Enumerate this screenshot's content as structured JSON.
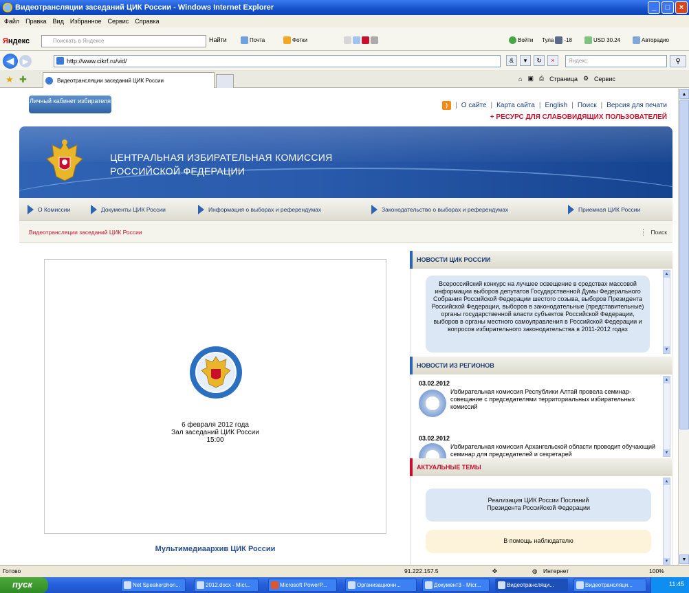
{
  "window": {
    "title": "Видеотрансляции заседаний ЦИК России - Windows Internet Explorer",
    "min": "_",
    "max": "□",
    "close": "×"
  },
  "menu": [
    "Файл",
    "Правка",
    "Вид",
    "Избранное",
    "Сервис",
    "Справка"
  ],
  "yandex_bar": {
    "brand": "ндекс",
    "brand_prefix": "Я",
    "search_placeholder": "Поискать в Яндексе",
    "find": "Найти",
    "mail": "Почта",
    "photos": "Фотки",
    "login": "Войти",
    "weather": "Тула",
    "temperature": "-18",
    "usd": "USD 30.24",
    "autoradio": "Авторадио"
  },
  "address_bar": {
    "url": "http://www.cikrf.ru/vid/",
    "search_placeholder": "Яндекс",
    "go": "⚲"
  },
  "tabs": {
    "active": "Видеотрансляции заседаний ЦИК России",
    "page_menu": "Страница",
    "tools_menu": "Сервис"
  },
  "site": {
    "cabinet_button": "Личный кабинет избирателя",
    "top_links": [
      "О сайте",
      "Карта сайта",
      "English",
      "Поиск",
      "Версия для печати"
    ],
    "accessibility_link": "+ РЕСУРС ДЛЯ СЛАБОВИДЯЩИХ ПОЛЬЗОВАТЕЛЕЙ",
    "banner_line1": "ЦЕНТРАЛЬНАЯ ИЗБИРАТЕЛЬНАЯ КОМИССИЯ",
    "banner_line2": "РОССИЙСКОЙ ФЕДЕРАЦИИ",
    "nav": [
      "О Комиссии",
      "Документы ЦИК России",
      "Информация о выборах и референдумах",
      "Законодательство о выборах и референдумах",
      "Приемная ЦИК России"
    ],
    "subnav_current": "Видеотрансляции заседаний ЦИК России",
    "subnav_search": "Поиск",
    "video": {
      "date": "6 февраля 2012 года",
      "place": "Зал заседаний ЦИК России",
      "time": "15:00"
    },
    "archive_link": "Мультимедиаархив ЦИК России",
    "news_cik": {
      "title": "НОВОСТИ ЦИК РОССИИ",
      "text": "Всероссийский конкурс на лучшее освещение в средствах массовой информации выборов депутатов Государственной Думы Федерального Собрания Российской Федерации шестого созыва, выборов Президента Российской Федерации, выборов в законодательные (представительные) органы государственной власти субъектов Российской Федерации, выборов в органы местного самоуправления в Российской Федерации и вопросов избирательного законодательства в 2011-2012 годах"
    },
    "news_regions": {
      "title": "НОВОСТИ ИЗ РЕГИОНОВ",
      "items": [
        {
          "date": "03.02.2012",
          "text": "Избирательная комиссия Республики Алтай провела семинар-совещание с председателями территориальных избирательных комиссий"
        },
        {
          "date": "03.02.2012",
          "text": "Избирательная комиссия Архангельской области проводит обучающий семинар для председателей и секретарей"
        }
      ]
    },
    "topics": {
      "title": "АКТУАЛЬНЫЕ ТЕМЫ",
      "item1": "Реализация ЦИК России Посланий Президента Российской Федерации",
      "item2": "В помощь наблюдателю"
    }
  },
  "status_bar": {
    "status": "Готово",
    "ip": "91.222.157.5",
    "zone": "Интернет",
    "zoom": "100%"
  },
  "taskbar": {
    "start": "пуск",
    "buttons": [
      "Net Speakerphon...",
      "2012.docx - Micr...",
      "Microsoft PowerP...",
      "Организационн...",
      "Документ3 - Micr...",
      "Видеотрансляци...",
      "Видеотрансляци..."
    ],
    "clock": "11:45"
  },
  "colors": {
    "accent": "#2f63b4",
    "alert": "#c8102e",
    "link": "#1d3b74"
  }
}
